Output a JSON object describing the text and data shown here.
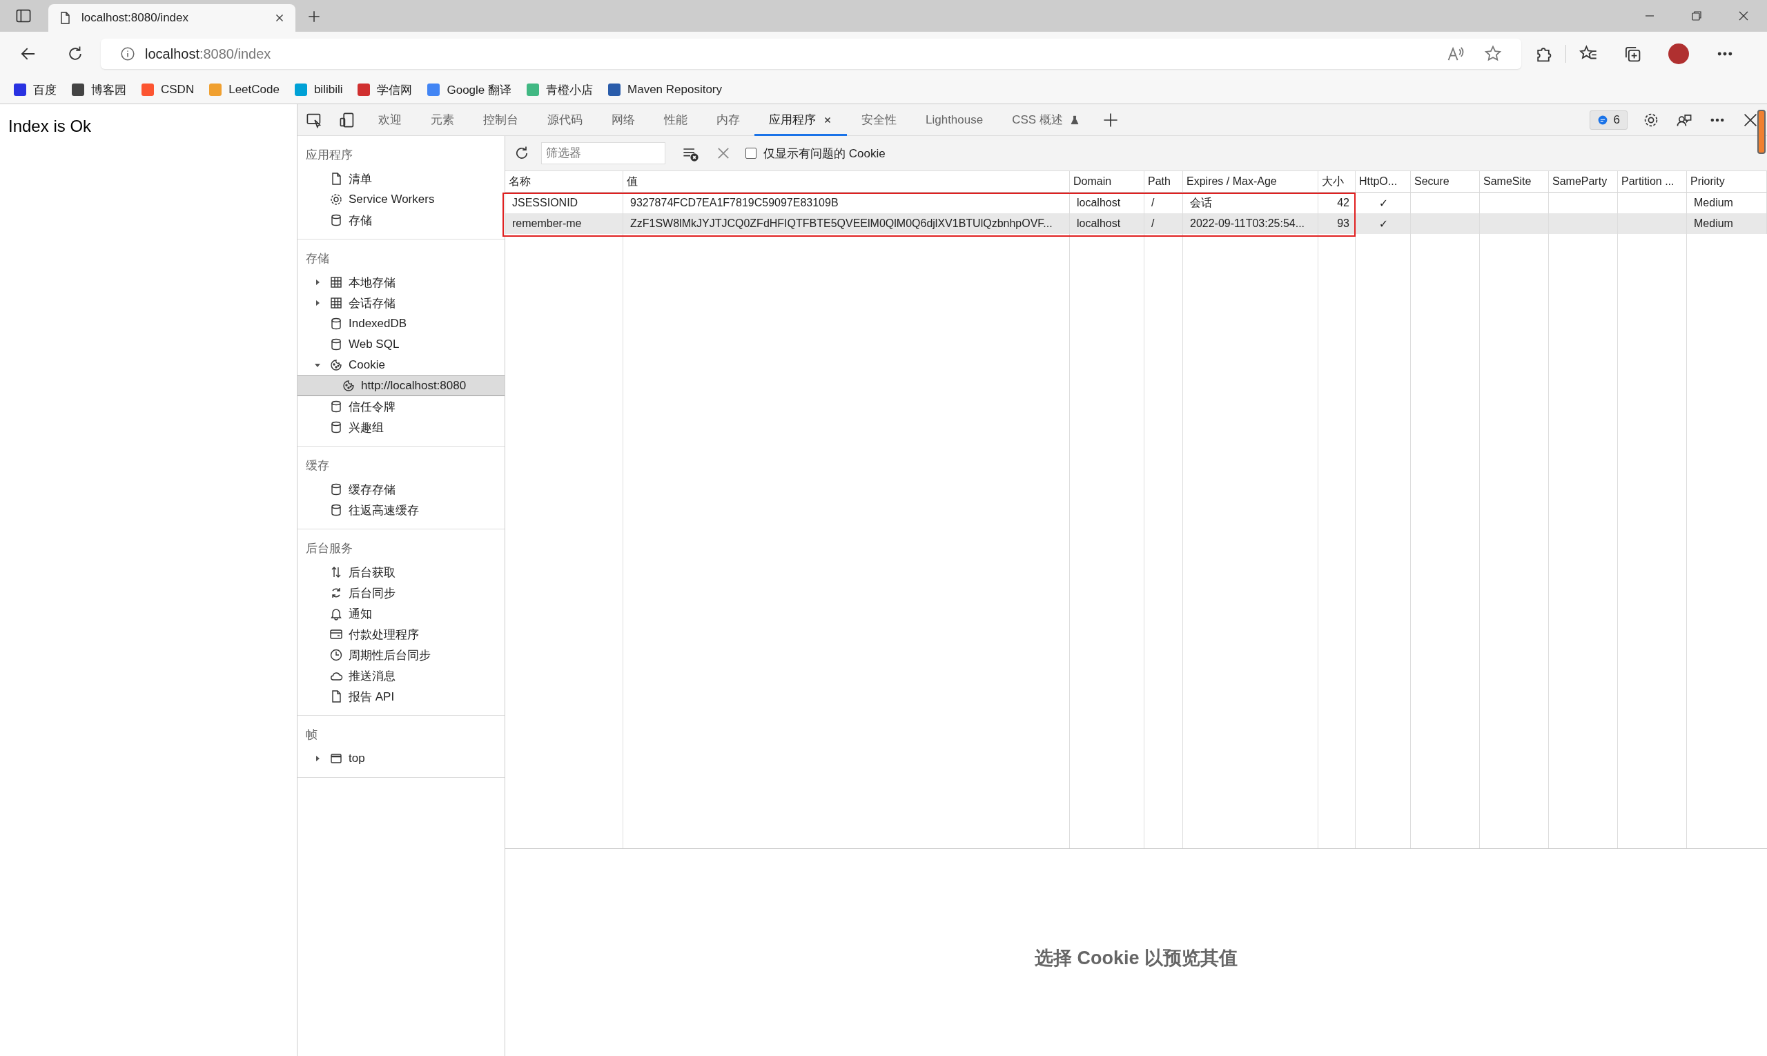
{
  "browser": {
    "tab": {
      "title": "localhost:8080/index"
    },
    "address": {
      "host": "localhost",
      "rest": ":8080/index"
    },
    "bookmarks": [
      {
        "label": "百度"
      },
      {
        "label": "博客园"
      },
      {
        "label": "CSDN"
      },
      {
        "label": "LeetCode"
      },
      {
        "label": "bilibili"
      },
      {
        "label": "学信网"
      },
      {
        "label": "Google 翻译"
      },
      {
        "label": "青橙小店"
      },
      {
        "label": "Maven Repository"
      }
    ]
  },
  "page": {
    "text": "Index is Ok"
  },
  "devtools": {
    "tabs": [
      {
        "label": "欢迎",
        "selected": false
      },
      {
        "label": "元素",
        "selected": false
      },
      {
        "label": "控制台",
        "selected": false
      },
      {
        "label": "源代码",
        "selected": false
      },
      {
        "label": "网络",
        "selected": false
      },
      {
        "label": "性能",
        "selected": false
      },
      {
        "label": "内存",
        "selected": false
      },
      {
        "label": "应用程序",
        "selected": true,
        "closable": true
      },
      {
        "label": "安全性",
        "selected": false
      },
      {
        "label": "Lighthouse",
        "selected": false
      },
      {
        "label": "CSS 概述",
        "selected": false,
        "experimental": true
      }
    ],
    "issues_badge": "6",
    "sidebar": {
      "sections": [
        {
          "title": "应用程序",
          "items": [
            {
              "label": "清单",
              "kind": "file",
              "selected": false
            },
            {
              "label": "Service Workers",
              "kind": "gear",
              "selected": false
            },
            {
              "label": "存储",
              "kind": "database",
              "selected": false
            }
          ]
        },
        {
          "title": "存储",
          "items": [
            {
              "label": "本地存储",
              "kind": "table",
              "selected": false,
              "expanded": false
            },
            {
              "label": "会话存储",
              "kind": "table",
              "selected": false,
              "expanded": false
            },
            {
              "label": "IndexedDB",
              "kind": "database",
              "selected": false
            },
            {
              "label": "Web SQL",
              "kind": "database",
              "selected": false
            },
            {
              "label": "Cookie",
              "kind": "cookie",
              "selected": false,
              "expanded": true,
              "children": [
                {
                  "label": "http://localhost:8080",
                  "kind": "cookie",
                  "selected": true
                }
              ]
            },
            {
              "label": "信任令牌",
              "kind": "database",
              "selected": false
            },
            {
              "label": "兴趣组",
              "kind": "database",
              "selected": false
            }
          ]
        },
        {
          "title": "缓存",
          "items": [
            {
              "label": "缓存存储",
              "kind": "database",
              "selected": false
            },
            {
              "label": "往返高速缓存",
              "kind": "database",
              "selected": false
            }
          ]
        },
        {
          "title": "后台服务",
          "items": [
            {
              "label": "后台获取",
              "kind": "updown",
              "selected": false
            },
            {
              "label": "后台同步",
              "kind": "sync",
              "selected": false
            },
            {
              "label": "通知",
              "kind": "bell",
              "selected": false
            },
            {
              "label": "付款处理程序",
              "kind": "card",
              "selected": false
            },
            {
              "label": "周期性后台同步",
              "kind": "clock",
              "selected": false
            },
            {
              "label": "推送消息",
              "kind": "cloud",
              "selected": false
            },
            {
              "label": "报告 API",
              "kind": "file",
              "selected": false
            }
          ]
        },
        {
          "title": "帧",
          "items": [
            {
              "label": "top",
              "kind": "frame",
              "selected": false,
              "expanded": false
            }
          ]
        }
      ]
    },
    "toolbar": {
      "filter_placeholder": "筛选器",
      "only_issues": {
        "label": "仅显示有问题的 Cookie",
        "checked": false
      }
    },
    "table": {
      "columns": [
        "名称",
        "值",
        "Domain",
        "Path",
        "Expires / Max-Age",
        "大小",
        "HttpO...",
        "Secure",
        "SameSite",
        "SameParty",
        "Partition ...",
        "Priority"
      ],
      "rows": [
        {
          "name": "JSESSIONID",
          "value": "9327874FCD7EA1F7819C59097E83109B",
          "domain": "localhost",
          "path": "/",
          "expires": "会话",
          "size": "42",
          "http_only": "✓",
          "priority": "Medium",
          "highlighted": true
        },
        {
          "name": "remember-me",
          "value": "ZzF1SW8lMkJYJTJCQ0ZFdHFIQTFBTE5QVEElM0QlM0Q6djlXV1BTUlQzbnhpOVF...",
          "domain": "localhost",
          "path": "/",
          "expires": "2022-09-11T03:25:54...",
          "size": "93",
          "http_only": "✓",
          "priority": "Medium",
          "highlighted": true
        }
      ]
    },
    "preview": {
      "message": "选择 Cookie 以预览其值"
    }
  }
}
